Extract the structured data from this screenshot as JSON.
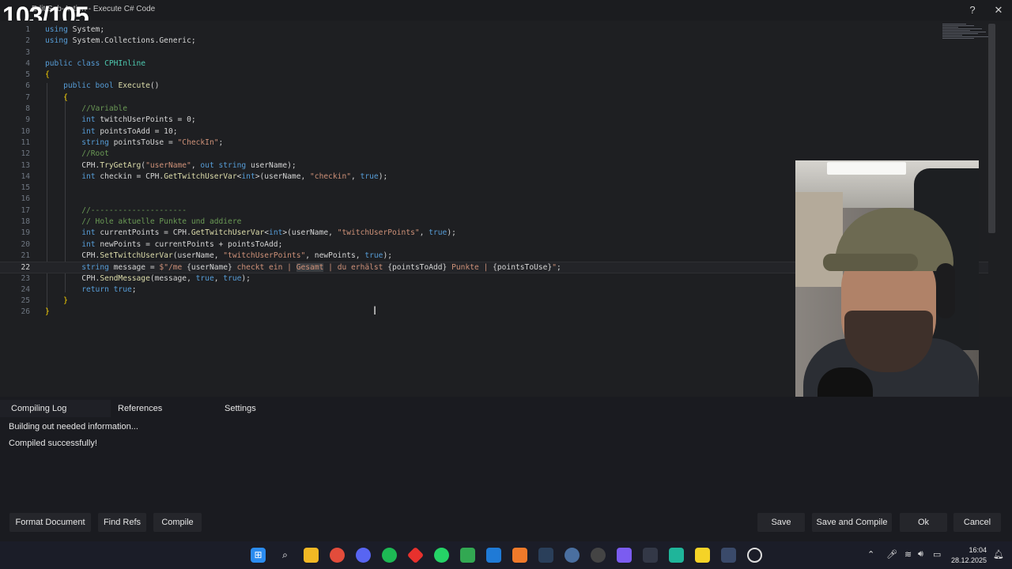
{
  "window": {
    "title": "Edit Sub-Action - Execute C# Code",
    "counter": "103/105",
    "help_label": "?",
    "close_label": "✕"
  },
  "code_lines": [
    {
      "n": "1",
      "html": "<span class=\"kw\">using</span> System;"
    },
    {
      "n": "2",
      "html": "<span class=\"kw\">using</span> System.Collections.Generic;"
    },
    {
      "n": "3",
      "html": ""
    },
    {
      "n": "4",
      "html": "<span class=\"kw\">public class</span> <span class=\"ty\">CPHInline</span>"
    },
    {
      "n": "5",
      "html": "<span class=\"br\">{</span>"
    },
    {
      "n": "6",
      "html": "    <span class=\"kw\">public bool</span> <span class=\"fn\">Execute</span>()"
    },
    {
      "n": "7",
      "html": "    <span class=\"br\">{</span>"
    },
    {
      "n": "8",
      "html": "        <span class=\"cm\">//Variable</span>"
    },
    {
      "n": "9",
      "html": "        <span class=\"kw\">int</span> twitchUserPoints = 0;"
    },
    {
      "n": "10",
      "html": "        <span class=\"kw\">int</span> pointsToAdd = 10;"
    },
    {
      "n": "11",
      "html": "        <span class=\"kw\">string</span> pointsToUse = <span class=\"str\">\"CheckIn\"</span>;"
    },
    {
      "n": "12",
      "html": "        <span class=\"cm\">//Root</span>"
    },
    {
      "n": "13",
      "html": "        CPH.<span class=\"fn\">TryGetArg</span>(<span class=\"str\">\"userName\"</span>, <span class=\"kw\">out string</span> userName);"
    },
    {
      "n": "14",
      "html": "        <span class=\"kw\">int</span> checkin = CPH.<span class=\"fn\">GetTwitchUserVar</span>&lt;<span class=\"kw\">int</span>&gt;(userName, <span class=\"str\">\"checkin\"</span>, <span class=\"kw\">true</span>);"
    },
    {
      "n": "15",
      "html": ""
    },
    {
      "n": "16",
      "html": ""
    },
    {
      "n": "17",
      "html": "        <span class=\"cm\">//---------------------</span>"
    },
    {
      "n": "18",
      "html": "        <span class=\"cm\">// Hole aktuelle Punkte und addiere</span>"
    },
    {
      "n": "19",
      "html": "        <span class=\"kw\">int</span> currentPoints = CPH.<span class=\"fn\">GetTwitchUserVar</span>&lt;<span class=\"kw\">int</span>&gt;(userName, <span class=\"str\">\"twitchUserPoints\"</span>, <span class=\"kw\">true</span>);"
    },
    {
      "n": "20",
      "html": "        <span class=\"kw\">int</span> newPoints = currentPoints + pointsToAdd;"
    },
    {
      "n": "21",
      "html": "        CPH.<span class=\"fn\">SetTwitchUserVar</span>(userName, <span class=\"str\">\"twitchUserPoints\"</span>, newPoints, <span class=\"kw\">true</span>);"
    },
    {
      "n": "22",
      "html": "        <span class=\"kw\">string</span> message = <span class=\"str\">$\"/me </span>{userName}<span class=\"str\"> checkt ein | </span><span class=\"str hl\">Gesamt</span><span class=\"str\"> | du erhälst </span>{pointsToAdd}<span class=\"str\"> Punkte | </span>{pointsToUse}<span class=\"str\">\"</span>;",
      "current": true
    },
    {
      "n": "23",
      "html": "        CPH.<span class=\"fn\">SendMessage</span>(message, <span class=\"kw\">true</span>, <span class=\"kw\">true</span>);"
    },
    {
      "n": "24",
      "html": "        <span class=\"kw\">return true</span>;"
    },
    {
      "n": "25",
      "html": "    <span class=\"br\">}</span>"
    },
    {
      "n": "26",
      "html": "<span class=\"br\">}</span>"
    }
  ],
  "tabs": {
    "compiling_log": "Compiling Log",
    "references": "References",
    "settings": "Settings"
  },
  "log": {
    "line1": "Building out needed information...",
    "line2": "Compiled successfully!"
  },
  "buttons": {
    "format_document": "Format Document",
    "find_refs": "Find Refs",
    "compile": "Compile",
    "save": "Save",
    "save_and_compile": "Save and Compile",
    "ok": "Ok",
    "cancel": "Cancel"
  },
  "taskbar": {
    "time": "16:04",
    "date": "28.12.2025"
  },
  "colors": {
    "keyword": "#569cd6",
    "string": "#ce9178",
    "comment": "#6a9955",
    "type": "#4ec9b0",
    "method": "#dcdcaa"
  }
}
